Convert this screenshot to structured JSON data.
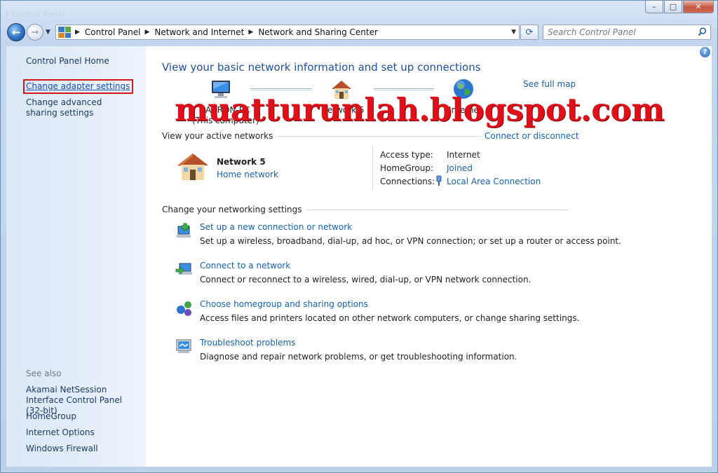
{
  "window": {
    "ghost_title": "4 Control Panel",
    "minimize": "–",
    "maximize": "□",
    "close": "✕"
  },
  "nav": {
    "back_glyph": "←",
    "forward_glyph": "→",
    "breadcrumbs": [
      "Control Panel",
      "Network and Internet",
      "Network and Sharing Center"
    ],
    "refresh_glyph": "⟳",
    "search_placeholder": "Search Control Panel"
  },
  "left_pane": {
    "home": "Control Panel Home",
    "change_adapter": "Change adapter settings",
    "change_sharing": "Change advanced sharing settings",
    "see_also": "See also",
    "akamai": "Akamai NetSession Interface Control Panel (32-bit)",
    "homegroup": "HomeGroup",
    "internet_options": "Internet Options",
    "firewall": "Windows Firewall"
  },
  "main": {
    "heading": "View your basic network information and set up connections",
    "see_full_map": "See full map",
    "map": {
      "computer_label_1": "AARON-PC",
      "computer_label_2": "(This computer)",
      "network_label": "Network 5",
      "internet_label": "Internet"
    },
    "active_networks_title": "View your active networks",
    "connect_disconnect": "Connect or disconnect",
    "network": {
      "name": "Network  5",
      "type": "Home network",
      "access_type_label": "Access type:",
      "access_type_value": "Internet",
      "homegroup_label": "HomeGroup:",
      "homegroup_value": "Joined",
      "connections_label": "Connections:",
      "connections_value": "Local Area Connection"
    },
    "change_settings_title": "Change your networking settings",
    "tasks": [
      {
        "title": "Set up a new connection or network",
        "desc": "Set up a wireless, broadband, dial-up, ad hoc, or VPN connection; or set up a router or access point."
      },
      {
        "title": "Connect to a network",
        "desc": "Connect or reconnect to a wireless, wired, dial-up, or VPN network connection."
      },
      {
        "title": "Choose homegroup and sharing options",
        "desc": "Access files and printers located on other network computers, or change sharing settings."
      },
      {
        "title": "Troubleshoot problems",
        "desc": "Diagnose and repair network problems, or get troubleshooting information."
      }
    ]
  },
  "watermark": "muatturunlah.blogspot.com",
  "colors": {
    "link": "#1561b0",
    "heading": "#1e4f9a",
    "highlight_box": "#d2141d",
    "watermark": "#e0101a"
  }
}
